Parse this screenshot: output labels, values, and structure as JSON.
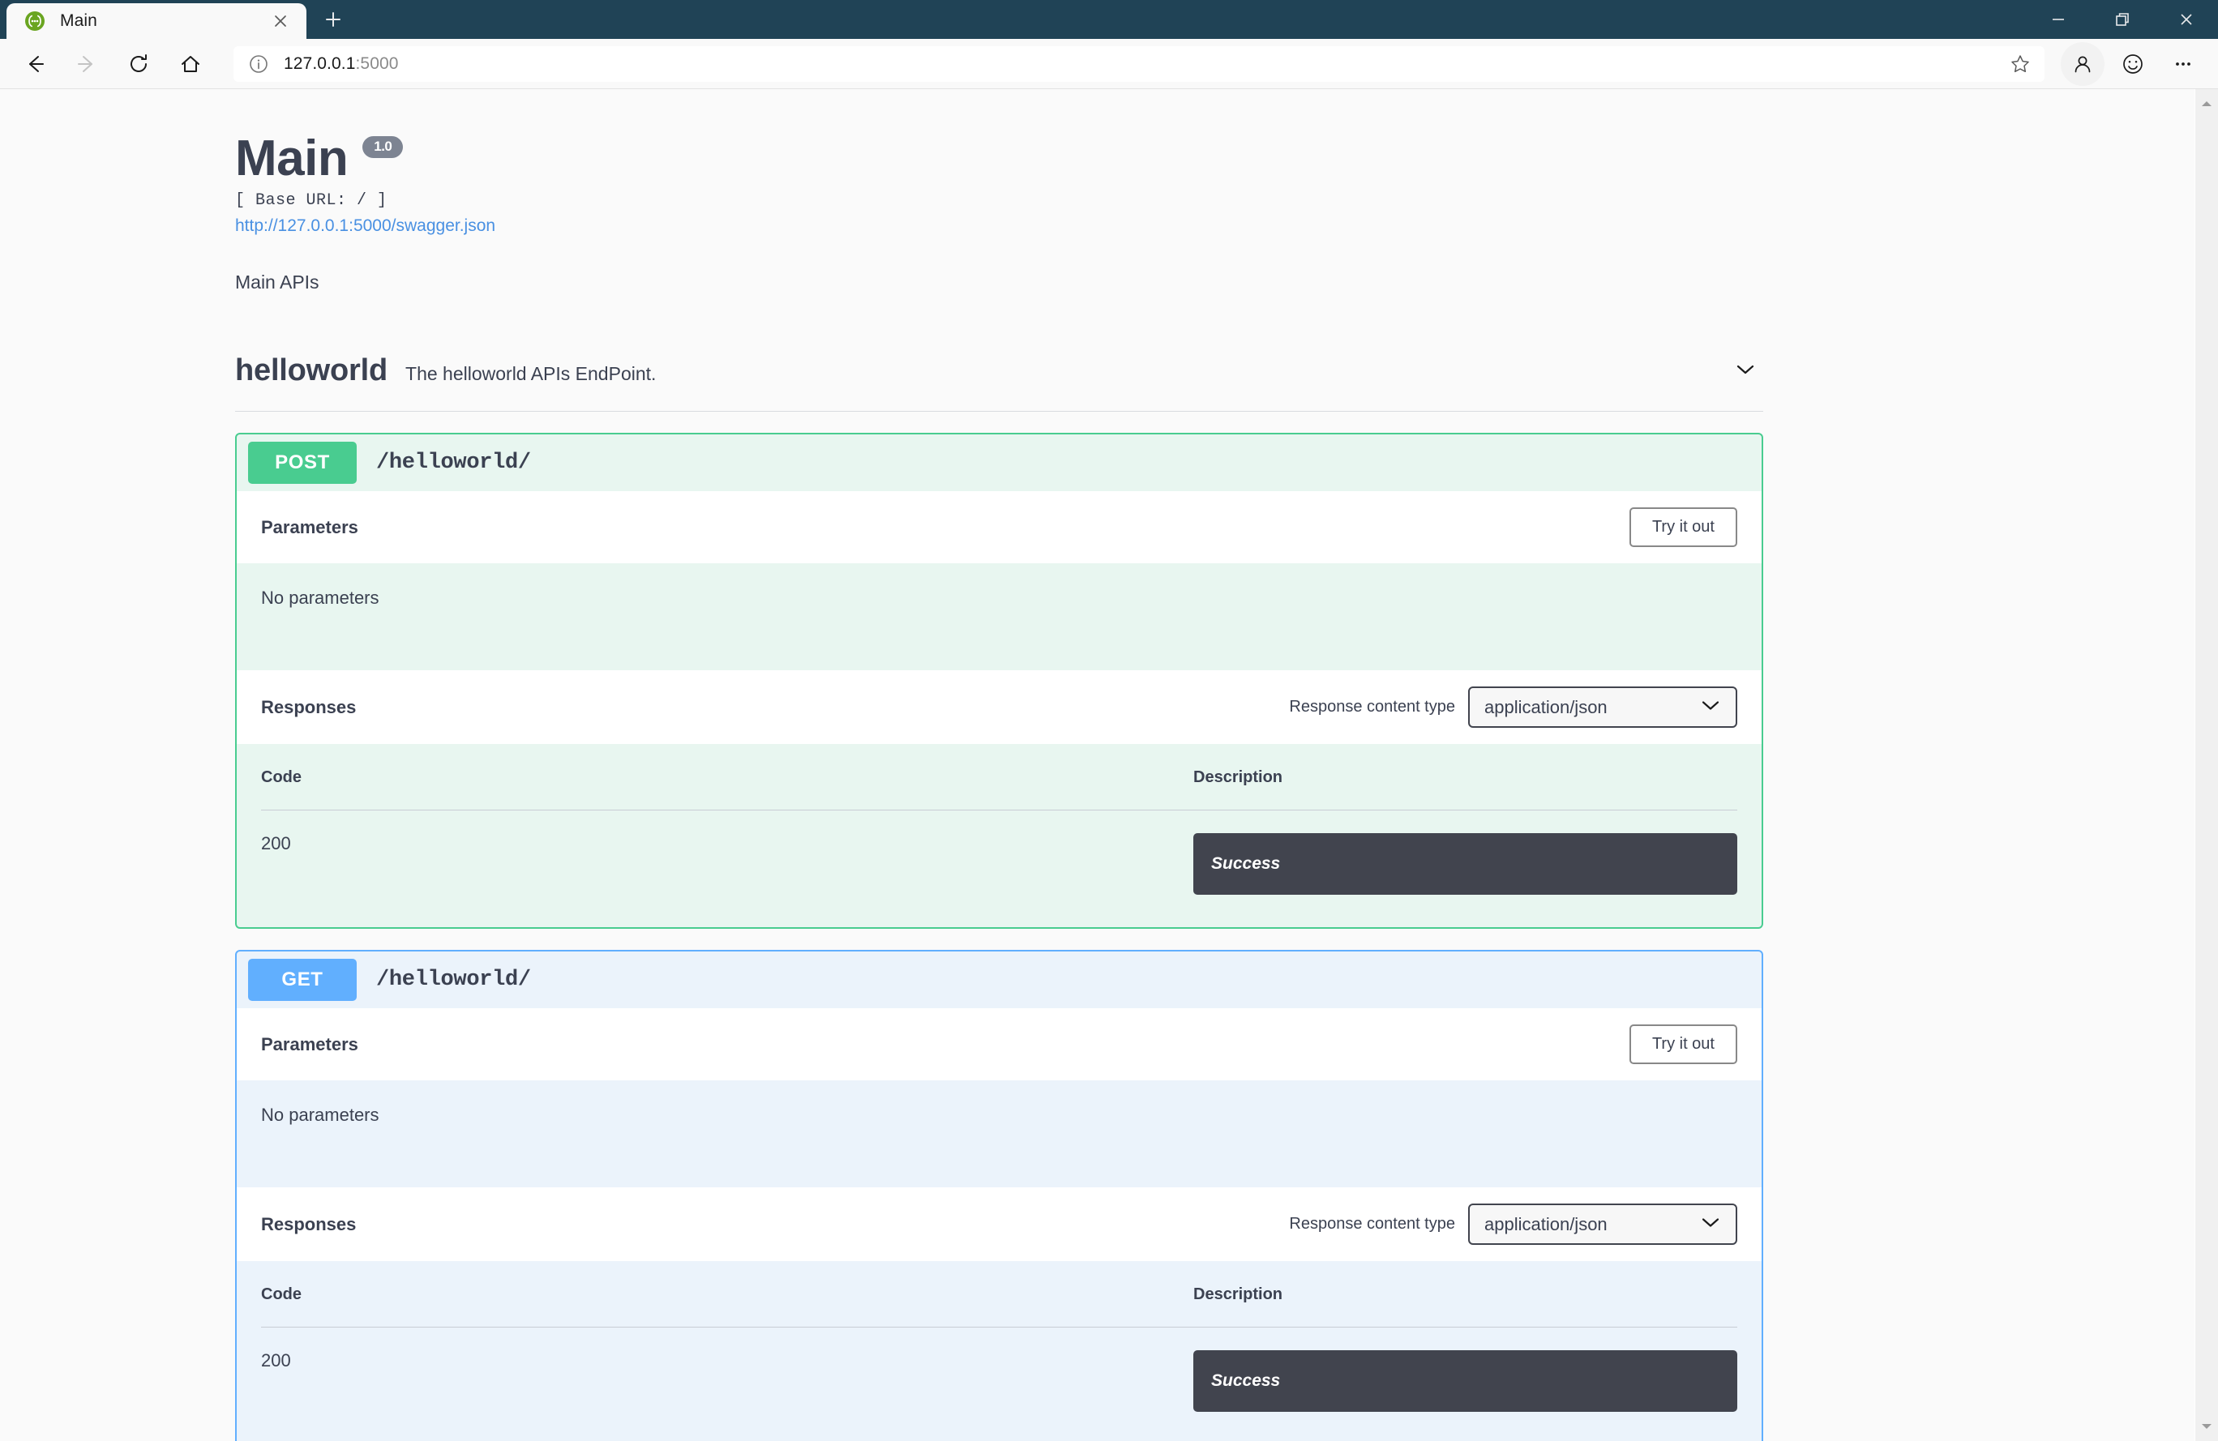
{
  "browser": {
    "tab": {
      "title": "Main",
      "favicon_icon": "swagger-logo-icon",
      "close_icon": "close-icon"
    },
    "new_tab_icon": "plus-icon",
    "window_controls": {
      "minimize_icon": "minimize-icon",
      "restore_icon": "restore-icon",
      "close_icon": "close-icon"
    },
    "toolbar": {
      "back_icon": "back-arrow-icon",
      "forward_icon": "forward-arrow-icon",
      "reload_icon": "reload-icon",
      "home_icon": "home-icon",
      "info_icon": "info-circle-icon",
      "url_host": "127.0.0.1",
      "url_port": ":5000",
      "star_icon": "star-icon",
      "profile_icon": "person-icon",
      "feedback_icon": "smiley-icon",
      "settings_icon": "ellipsis-icon"
    },
    "scrollbar": {
      "up_icon": "scroll-up-arrow-icon",
      "down_icon": "scroll-down-arrow-icon"
    }
  },
  "swagger": {
    "title": "Main",
    "version": "1.0",
    "base_url": "[ Base URL: / ]",
    "spec_link": "http://127.0.0.1:5000/swagger.json",
    "description": "Main APIs",
    "tag": {
      "name": "helloworld",
      "description": "The helloworld APIs EndPoint.",
      "toggle_icon": "chevron-down-icon"
    },
    "operations": [
      {
        "method": "POST",
        "path": "/helloworld/",
        "parameters_title": "Parameters",
        "try_it_out_label": "Try it out",
        "no_parameters_text": "No parameters",
        "responses_title": "Responses",
        "content_type_label": "Response content type",
        "content_type_value": "application/json",
        "content_type_options": [
          "application/json"
        ],
        "columns": {
          "code": "Code",
          "description": "Description"
        },
        "rows": [
          {
            "code": "200",
            "description": "Success"
          }
        ]
      },
      {
        "method": "GET",
        "path": "/helloworld/",
        "parameters_title": "Parameters",
        "try_it_out_label": "Try it out",
        "no_parameters_text": "No parameters",
        "responses_title": "Responses",
        "content_type_label": "Response content type",
        "content_type_value": "application/json",
        "content_type_options": [
          "application/json"
        ],
        "columns": {
          "code": "Code",
          "description": "Description"
        },
        "rows": [
          {
            "code": "200",
            "description": "Success"
          }
        ]
      }
    ]
  },
  "colors": {
    "titlebar": "#204356",
    "post_accent": "#49cc90",
    "get_accent": "#61affe",
    "code_block": "#41444e",
    "link": "#4990e2",
    "version_badge": "#7d8492"
  }
}
